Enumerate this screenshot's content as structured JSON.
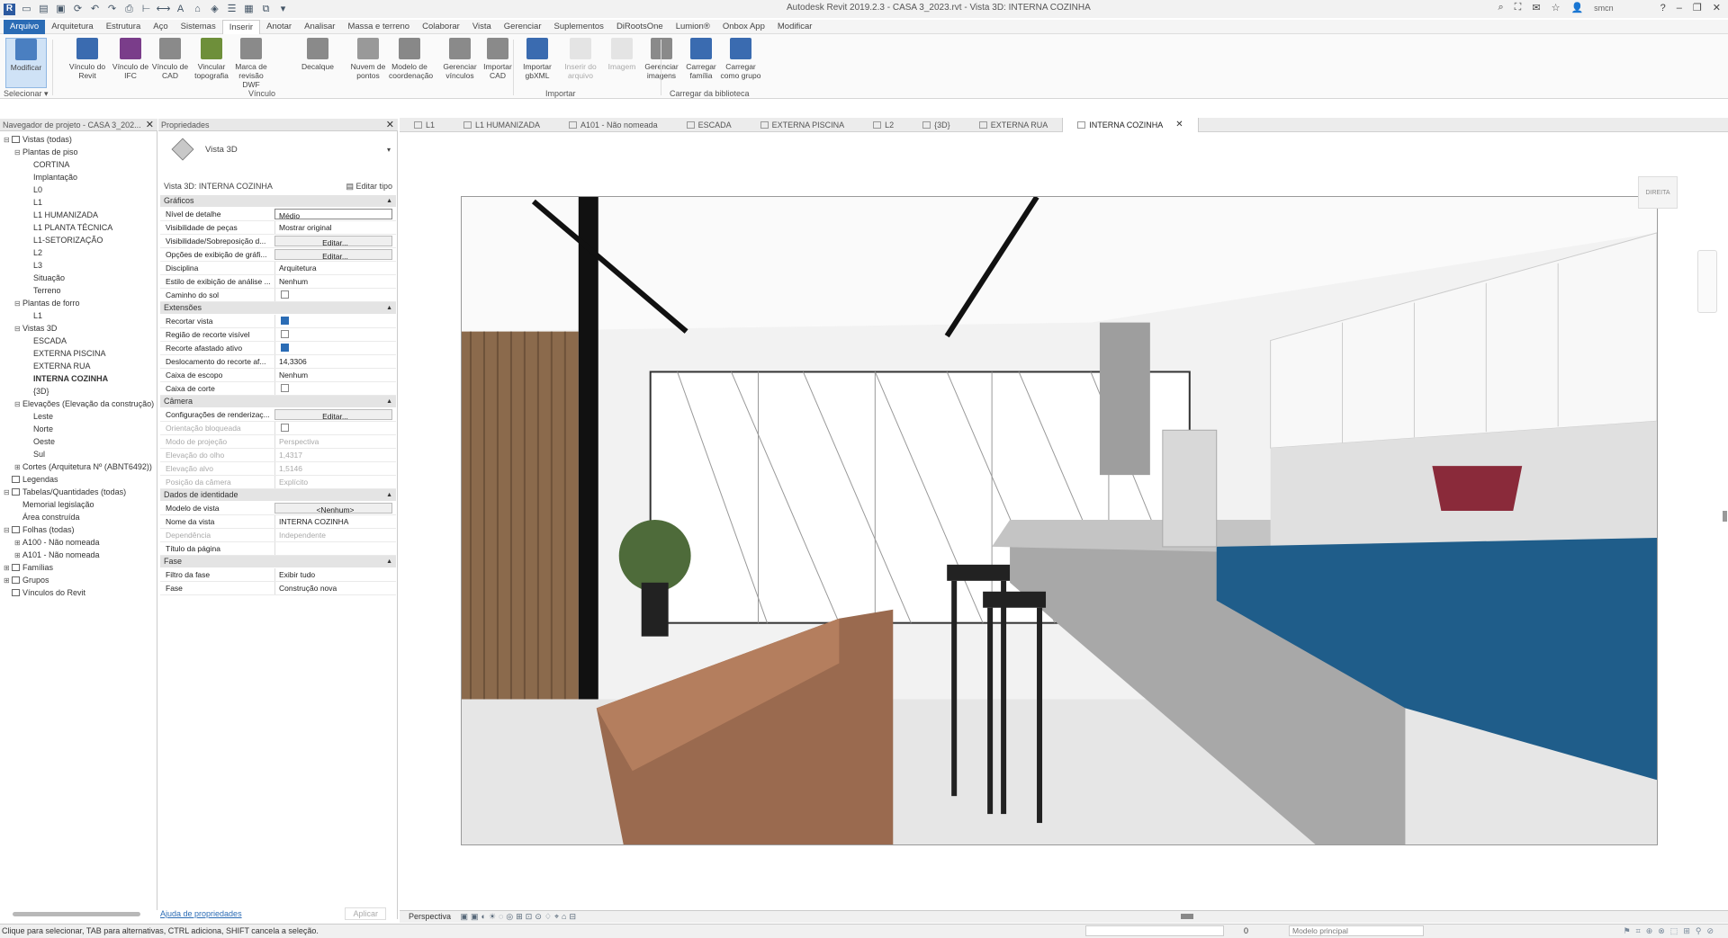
{
  "window": {
    "title": "Autodesk Revit 2019.2.3 - CASA 3_2023.rvt - Vista 3D: INTERNA COZINHA",
    "user": "smcn"
  },
  "menu": {
    "tabs": [
      "Arquivo",
      "Arquitetura",
      "Estrutura",
      "Aço",
      "Sistemas",
      "Inserir",
      "Anotar",
      "Analisar",
      "Massa e terreno",
      "Colaborar",
      "Vista",
      "Gerenciar",
      "Suplementos",
      "DiRootsOne",
      "Lumion®",
      "Onbox App",
      "Modificar"
    ],
    "active": "Inserir"
  },
  "ribbon": {
    "buttons": [
      {
        "label": "Modificar",
        "color": "#4a7fc1"
      },
      {
        "label": "Vínculo do Revit",
        "color": "#3a6bb0"
      },
      {
        "label": "Vínculo de IFC",
        "color": "#7a3d8a"
      },
      {
        "label": "Vínculo de CAD",
        "color": "#8a8a8a"
      },
      {
        "label": "Vincular topografia",
        "color": "#6e8f3a"
      },
      {
        "label": "Marca de revisão DWF",
        "color": "#8a8a8a"
      },
      {
        "label": "Decalque",
        "color": "#8a8a8a"
      },
      {
        "label": "Nuvem de pontos",
        "color": "#999999"
      },
      {
        "label": "Modelo de coordenação",
        "color": "#888888"
      },
      {
        "label": "Gerenciar vínculos",
        "color": "#8a8a8a"
      },
      {
        "label": "Importar CAD",
        "color": "#8a8a8a"
      },
      {
        "label": "Importar gbXML",
        "color": "#3a6bb0"
      },
      {
        "label": "Inserir do arquivo",
        "color": "#bbbbbb"
      },
      {
        "label": "Imagem",
        "color": "#bbbbbb"
      },
      {
        "label": "Gerenciar imagens",
        "color": "#8a8a8a"
      },
      {
        "label": "Carregar família",
        "color": "#3a6bb0"
      },
      {
        "label": "Carregar como grupo",
        "color": "#3a6bb0"
      }
    ],
    "groups": {
      "select": "Selecionar ▾",
      "link": "Vínculo",
      "import": "Importar",
      "library": "Carregar da biblioteca"
    }
  },
  "browser": {
    "title": "Navegador de projeto - CASA 3_202...",
    "tree": [
      {
        "label": "Vistas (todas)",
        "exp": "⊟"
      },
      {
        "label": "Plantas de piso",
        "exp": "⊟"
      },
      {
        "label": "CORTINA",
        "exp": ""
      },
      {
        "label": "Implantação",
        "exp": ""
      },
      {
        "label": "L0",
        "exp": ""
      },
      {
        "label": "L1",
        "exp": ""
      },
      {
        "label": "L1 HUMANIZADA",
        "exp": ""
      },
      {
        "label": "L1 PLANTA TÉCNICA",
        "exp": ""
      },
      {
        "label": "L1-SETORIZAÇÃO",
        "exp": ""
      },
      {
        "label": "L2",
        "exp": ""
      },
      {
        "label": "L3",
        "exp": ""
      },
      {
        "label": "Situação",
        "exp": ""
      },
      {
        "label": "Terreno",
        "exp": ""
      },
      {
        "label": "Plantas de forro",
        "exp": "⊟"
      },
      {
        "label": "L1",
        "exp": ""
      },
      {
        "label": "Vistas 3D",
        "exp": "⊟"
      },
      {
        "label": "ESCADA",
        "exp": ""
      },
      {
        "label": "EXTERNA PISCINA",
        "exp": ""
      },
      {
        "label": "EXTERNA RUA",
        "exp": ""
      },
      {
        "label": "INTERNA COZINHA",
        "exp": ""
      },
      {
        "label": "{3D}",
        "exp": ""
      },
      {
        "label": "Elevações (Elevação da construção)",
        "exp": "⊟"
      },
      {
        "label": "Leste",
        "exp": ""
      },
      {
        "label": "Norte",
        "exp": ""
      },
      {
        "label": "Oeste",
        "exp": ""
      },
      {
        "label": "Sul",
        "exp": ""
      },
      {
        "label": "Cortes (Arquitetura Nº (ABNT6492))",
        "exp": "⊞"
      },
      {
        "label": "Legendas",
        "exp": ""
      },
      {
        "label": "Tabelas/Quantidades (todas)",
        "exp": "⊟"
      },
      {
        "label": "Memorial legislação",
        "exp": ""
      },
      {
        "label": "Área construída",
        "exp": ""
      },
      {
        "label": "Folhas (todas)",
        "exp": "⊟"
      },
      {
        "label": "A100 - Não nomeada",
        "exp": "⊞"
      },
      {
        "label": "A101 - Não nomeada",
        "exp": "⊞"
      },
      {
        "label": "Famílias",
        "exp": "⊞"
      },
      {
        "label": "Grupos",
        "exp": "⊞"
      },
      {
        "label": "Vínculos do Revit",
        "exp": ""
      }
    ]
  },
  "props": {
    "title": "Propriedades",
    "type_name": "Vista 3D",
    "instance": "Vista 3D: INTERNA COZINHA",
    "edit_type": "Editar tipo",
    "sections": [
      {
        "title": "Gráficos",
        "rows": [
          {
            "label": "Nível de detalhe",
            "value": "Médio",
            "style": "box"
          },
          {
            "label": "Visibilidade de peças",
            "value": "Mostrar original"
          },
          {
            "label": "Visibilidade/Sobreposição d...",
            "value": "Editar...",
            "style": "btn"
          },
          {
            "label": "Opções de exibição de gráfi...",
            "value": "Editar...",
            "style": "btn"
          },
          {
            "label": "Disciplina",
            "value": "Arquitetura"
          },
          {
            "label": "Estilo de exibição de análise ...",
            "value": "Nenhum"
          },
          {
            "label": "Caminho do sol",
            "check": "off"
          }
        ]
      },
      {
        "title": "Extensões",
        "rows": [
          {
            "label": "Recortar vista",
            "check": "on"
          },
          {
            "label": "Região de recorte visível",
            "check": "off"
          },
          {
            "label": "Recorte afastado ativo",
            "check": "on"
          },
          {
            "label": "Deslocamento do recorte af...",
            "value": "14,3306"
          },
          {
            "label": "Caixa de escopo",
            "value": "Nenhum"
          },
          {
            "label": "Caixa de corte",
            "check": "off"
          }
        ]
      },
      {
        "title": "Câmera",
        "rows": [
          {
            "label": "Configurações de renderizaç...",
            "value": "Editar...",
            "style": "btn"
          },
          {
            "label": "Orientação bloqueada",
            "check": "off",
            "dim": true
          },
          {
            "label": "Modo de projeção",
            "value": "Perspectiva",
            "dim": true
          },
          {
            "label": "Elevação do olho",
            "value": "1,4317",
            "dim": true
          },
          {
            "label": "Elevação alvo",
            "value": "1,5146",
            "dim": true
          },
          {
            "label": "Posição da câmera",
            "value": "Explícito",
            "dim": true
          }
        ]
      },
      {
        "title": "Dados de identidade",
        "rows": [
          {
            "label": "Modelo de vista",
            "value": "<Nenhum>",
            "style": "btn"
          },
          {
            "label": "Nome da vista",
            "value": "INTERNA COZINHA"
          },
          {
            "label": "Dependência",
            "value": "Independente",
            "dim": true
          },
          {
            "label": "Título da página",
            "value": ""
          }
        ]
      },
      {
        "title": "Fase",
        "rows": [
          {
            "label": "Filtro da fase",
            "value": "Exibir tudo"
          },
          {
            "label": "Fase",
            "value": "Construção nova"
          }
        ]
      }
    ],
    "help": "Ajuda de propriedades",
    "apply": "Aplicar"
  },
  "view_tabs": [
    {
      "label": "L1"
    },
    {
      "label": "L1 HUMANIZADA"
    },
    {
      "label": "A101 - Não nomeada"
    },
    {
      "label": "ESCADA"
    },
    {
      "label": "EXTERNA PISCINA"
    },
    {
      "label": "L2"
    },
    {
      "label": "{3D}"
    },
    {
      "label": "EXTERNA RUA"
    },
    {
      "label": "INTERNA COZINHA",
      "active": true
    }
  ],
  "viewcube": {
    "face": "DIREITA"
  },
  "view_control": {
    "projection": "Perspectiva"
  },
  "status": {
    "hint": "Clique para selecionar, TAB para alternativas, CTRL adiciona, SHIFT cancela a seleção.",
    "coord": "0",
    "model": "Modelo principal"
  },
  "scene_colors": {
    "sofa": "#9a6a4f",
    "cabinet": "#1f5d8a",
    "island": "#a8a8a8",
    "wall": "#f4f4f4",
    "wood": "#8b6a4c"
  }
}
